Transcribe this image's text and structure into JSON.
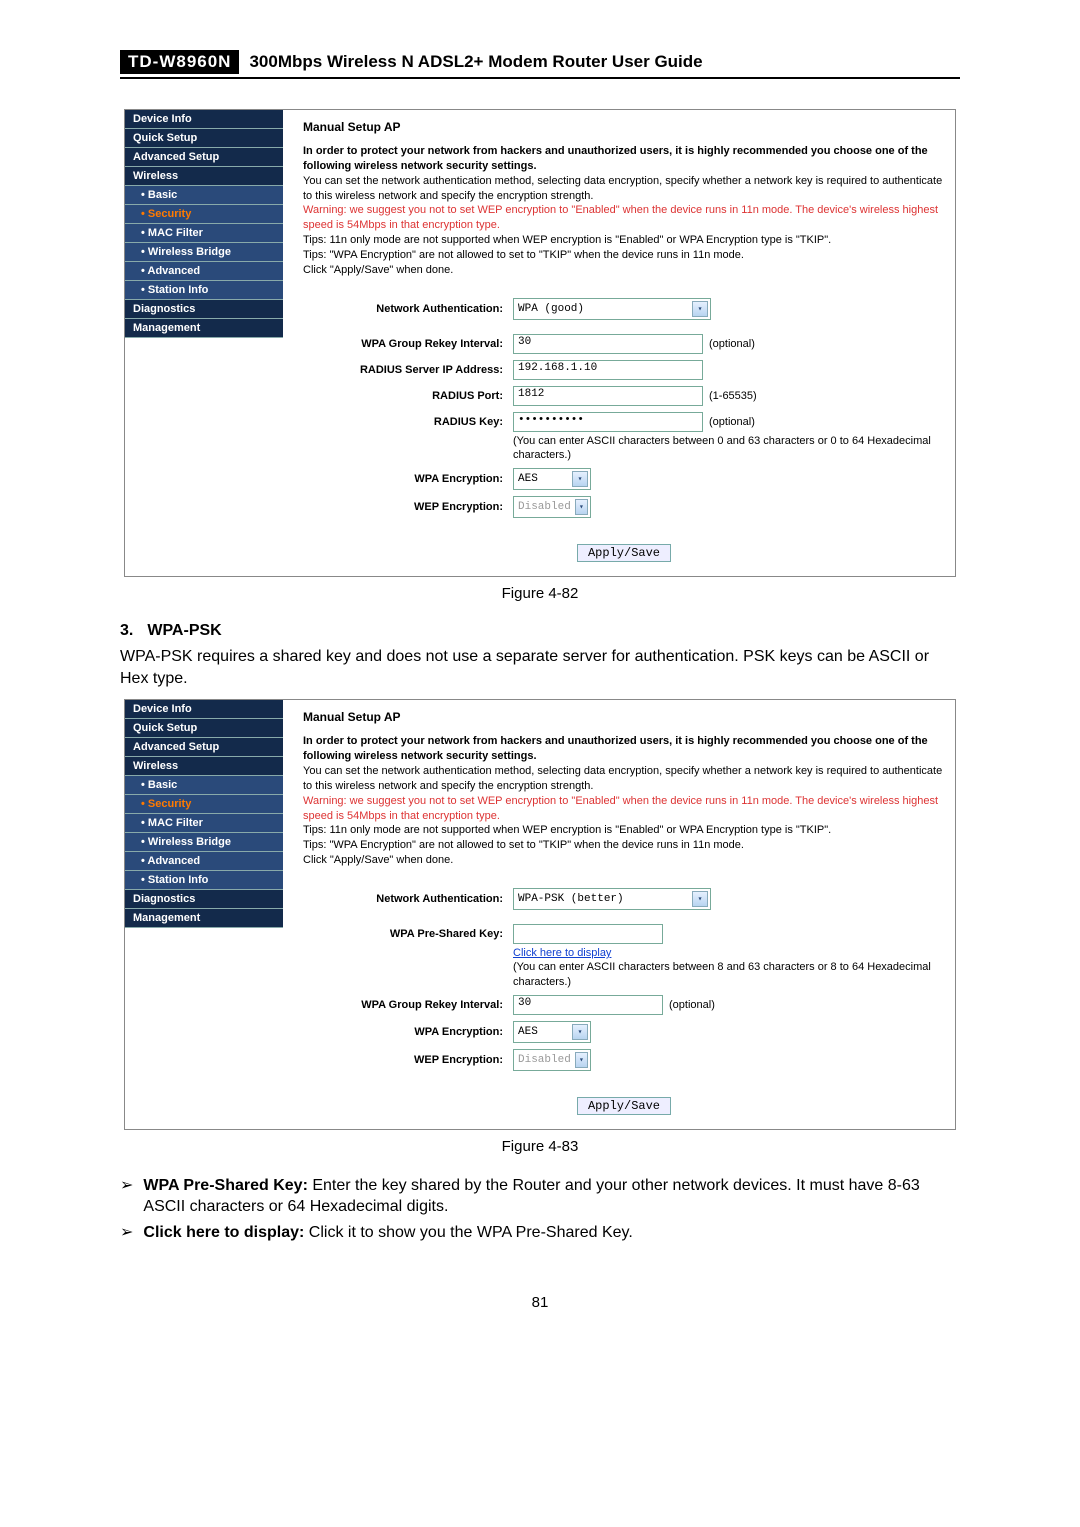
{
  "header": {
    "model": "TD-W8960N",
    "title": "300Mbps Wireless N ADSL2+ Modem Router User Guide"
  },
  "nav": {
    "items": [
      {
        "label": "Device Info",
        "type": "top"
      },
      {
        "label": "Quick Setup",
        "type": "top"
      },
      {
        "label": "Advanced Setup",
        "type": "top"
      },
      {
        "label": "Wireless",
        "type": "top"
      },
      {
        "label": "• Basic",
        "type": "sub"
      },
      {
        "label": "• Security",
        "type": "sub",
        "active": true
      },
      {
        "label": "• MAC Filter",
        "type": "sub"
      },
      {
        "label": "• Wireless Bridge",
        "type": "sub"
      },
      {
        "label": "• Advanced",
        "type": "sub"
      },
      {
        "label": "• Station Info",
        "type": "sub"
      },
      {
        "label": "Diagnostics",
        "type": "top"
      },
      {
        "label": "Management",
        "type": "top"
      }
    ]
  },
  "shot1": {
    "title": "Manual Setup AP",
    "intro_bold": "In order to protect your network from hackers and unauthorized users, it is highly recommended you choose one of the following wireless network security settings.",
    "intro_p2": "You can set the network authentication method, selecting data encryption, specify whether a network key is required to authenticate to this wireless network and specify the encryption strength.",
    "warning": "Warning: we suggest you not to set WEP encryption to \"Enabled\" when the device runs in 11n mode. The device's wireless highest speed is 54Mbps in that encryption type.",
    "tips1": "Tips: 11n only mode are not supported when WEP encryption is \"Enabled\" or WPA Encryption type is \"TKIP\".",
    "tips2": "Tips: \"WPA Encryption\" are not allowed to set to \"TKIP\" when the device runs in 11n mode.",
    "done": "Click \"Apply/Save\" when done.",
    "fields": {
      "net_auth_label": "Network Authentication:",
      "net_auth_value": "WPA (good)",
      "rekey_label": "WPA Group Rekey Interval:",
      "rekey_value": "30",
      "rekey_hint": "(optional)",
      "radius_ip_label": "RADIUS Server IP Address:",
      "radius_ip_value": "192.168.1.10",
      "radius_port_label": "RADIUS Port:",
      "radius_port_value": "1812",
      "radius_port_hint": "(1-65535)",
      "radius_key_label": "RADIUS Key:",
      "radius_key_value": "••••••••••",
      "radius_key_hint": "(optional)",
      "radius_key_note": "(You can enter ASCII characters between 0 and 63 characters or 0 to 64 Hexadecimal characters.)",
      "wpa_enc_label": "WPA Encryption:",
      "wpa_enc_value": "AES",
      "wep_enc_label": "WEP Encryption:",
      "wep_enc_value": "Disabled"
    },
    "apply": "Apply/Save",
    "caption": "Figure 4-82"
  },
  "section3": {
    "num": "3.",
    "title": "WPA-PSK",
    "para": "WPA-PSK requires a shared key and does not use a separate server for authentication. PSK keys can be ASCII or Hex type."
  },
  "shot2": {
    "title": "Manual Setup AP",
    "intro_bold": "In order to protect your network from hackers and unauthorized users, it is highly recommended you choose one of the following wireless network security settings.",
    "intro_p2": "You can set the network authentication method, selecting data encryption, specify whether a network key is required to authenticate to this wireless network and specify the encryption strength.",
    "warning": "Warning: we suggest you not to set WEP encryption to \"Enabled\" when the device runs in 11n mode. The device's wireless highest speed is 54Mbps in that encryption type.",
    "tips1": "Tips: 11n only mode are not supported when WEP encryption is \"Enabled\" or WPA Encryption type is \"TKIP\".",
    "tips2": "Tips: \"WPA Encryption\" are not allowed to set to \"TKIP\" when the device runs in 11n mode.",
    "done": "Click \"Apply/Save\" when done.",
    "fields": {
      "net_auth_label": "Network Authentication:",
      "net_auth_value": "WPA-PSK (better)",
      "psk_label": "WPA Pre-Shared Key:",
      "psk_link": "Click here to display",
      "psk_note": "(You can enter ASCII characters between 8 and 63 characters or 8 to 64 Hexadecimal characters.)",
      "rekey_label": "WPA Group Rekey Interval:",
      "rekey_value": "30",
      "rekey_hint": "(optional)",
      "wpa_enc_label": "WPA Encryption:",
      "wpa_enc_value": "AES",
      "wep_enc_label": "WEP Encryption:",
      "wep_enc_value": "Disabled"
    },
    "apply": "Apply/Save",
    "caption": "Figure 4-83"
  },
  "bullets": {
    "b1_bold": "WPA Pre-Shared Key:",
    "b1_rest": " Enter the key shared by the Router and your other network devices. It must have 8-63 ASCII characters or 64 Hexadecimal digits.",
    "b2_bold": "Click here to display:",
    "b2_rest": " Click it to show you the WPA Pre-Shared Key."
  },
  "page_number": "81"
}
